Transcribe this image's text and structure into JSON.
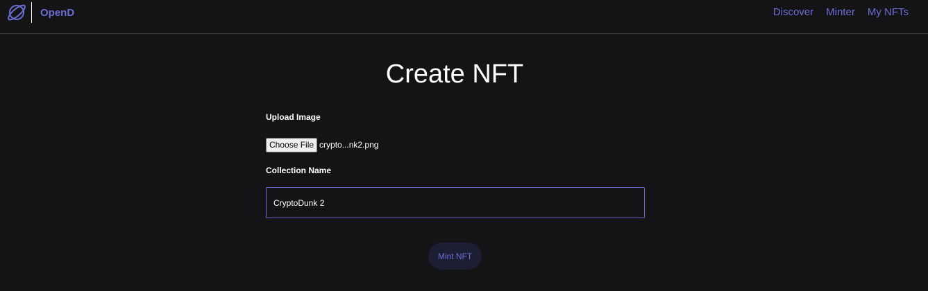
{
  "header": {
    "brand_name": "OpenD",
    "logo_icon": "planet-icon",
    "nav": [
      {
        "label": "Discover"
      },
      {
        "label": "Minter"
      },
      {
        "label": "My NFTs"
      }
    ]
  },
  "main": {
    "title": "Create NFT",
    "upload_label": "Upload Image",
    "choose_file_label": "Choose File",
    "file_name": "crypto...nk2.png",
    "collection_label": "Collection Name",
    "collection_value": "CryptoDunk 2",
    "mint_label": "Mint NFT"
  },
  "colors": {
    "background": "#141416",
    "accent": "#6b6fd4",
    "button_bg": "#1c1e33"
  }
}
